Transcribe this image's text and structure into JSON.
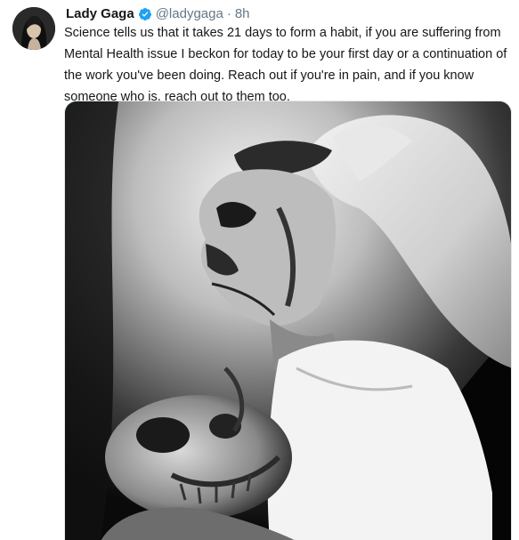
{
  "tweet": {
    "author_name": "Lady Gaga",
    "author_handle": "@ladygaga",
    "separator": "·",
    "timestamp": "8h",
    "text": "Science tells us that it takes 21 days to form a habit, if you are suffering from Mental Health issue I beckon for today to be your first day or a continuation of the work you've been doing. Reach out if you're in pain, and if you know someone who is, reach out to them too.",
    "verified_badge_color": "#1da1f2",
    "avatar_icon": "profile-photo",
    "media_icon": "black-and-white-photo"
  }
}
